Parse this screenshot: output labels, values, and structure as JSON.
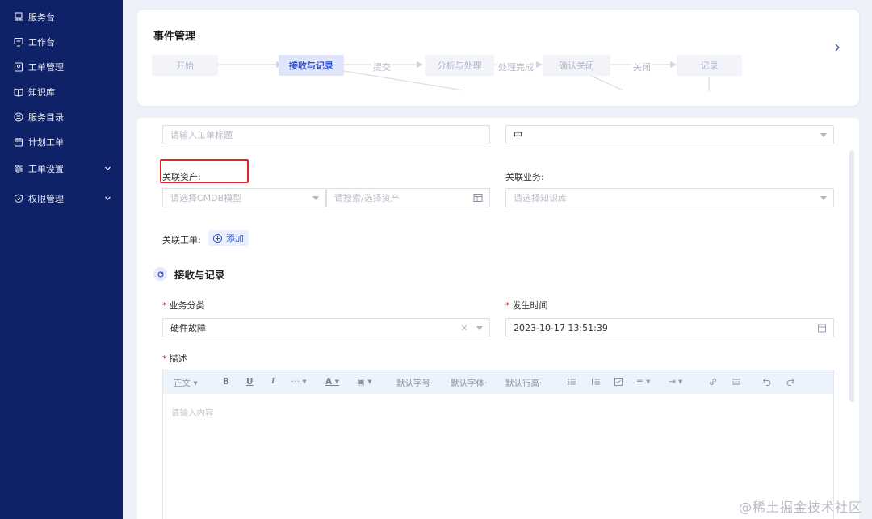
{
  "sidebar": {
    "items": [
      {
        "label": "服务台",
        "icon": "desk-icon"
      },
      {
        "label": "工作台",
        "icon": "monitor-icon"
      },
      {
        "label": "工单管理",
        "icon": "ticket-icon"
      },
      {
        "label": "知识库",
        "icon": "book-icon"
      },
      {
        "label": "服务目录",
        "icon": "catalog-icon"
      },
      {
        "label": "计划工单",
        "icon": "calendar-icon"
      },
      {
        "label": "工单设置",
        "icon": "settings-sliders-icon",
        "expandable": true
      },
      {
        "label": "权限管理",
        "icon": "shield-icon",
        "expandable": true
      }
    ]
  },
  "flow": {
    "title": "事件管理",
    "steps": [
      "开始",
      "接收与记录",
      "分析与处理",
      "确认关闭",
      "记录"
    ],
    "active_step": "接收与记录",
    "transitions": [
      "提交",
      "处理完成",
      "关闭"
    ]
  },
  "form": {
    "title_placeholder": "请输入工单标题",
    "priority_value": "中",
    "asset_label": "关联资产:",
    "asset_model_placeholder": "请选择CMDB模型",
    "asset_search_placeholder": "请搜索/选择资产",
    "business_label": "关联业务:",
    "business_placeholder": "请选择知识库",
    "ticket_link_label": "关联工单:",
    "add_label": "添加",
    "section_title": "接收与记录",
    "category_label": "业务分类",
    "category_value": "硬件故障",
    "time_label": "发生时间",
    "time_value": "2023-10-17 13:51:39",
    "desc_label": "描述",
    "desc_placeholder": "请输入内容"
  },
  "editor_toolbar": {
    "paragraph": "正文",
    "bold": "B",
    "underline": "U",
    "italic": "I",
    "more": "···",
    "font_color": "A",
    "font_size": "默认字号",
    "font_family": "默认字体",
    "line_height": "默认行高"
  },
  "watermark": "@稀土掘金技术社区",
  "colors": {
    "sidebar_bg": "#0f2167",
    "accent": "#3151c9",
    "highlight_border": "#e3262b",
    "required_mark": "#e1251b"
  }
}
